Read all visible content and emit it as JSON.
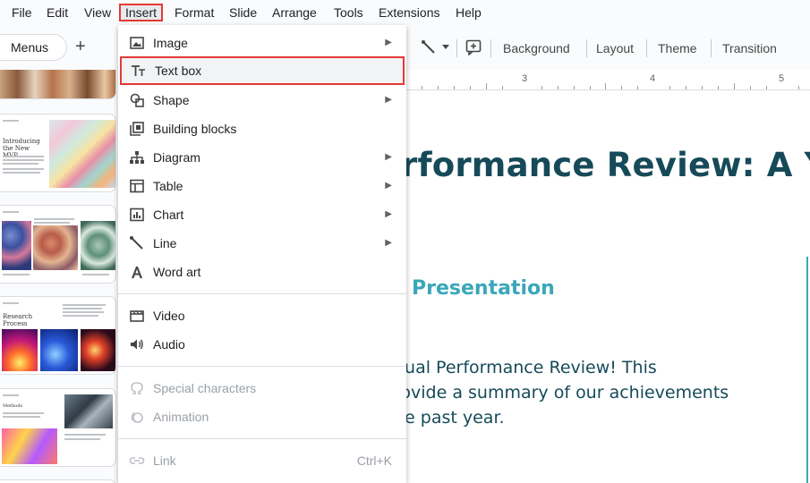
{
  "menubar": {
    "items": [
      {
        "label": "File"
      },
      {
        "label": "Edit"
      },
      {
        "label": "View"
      },
      {
        "label": "Insert"
      },
      {
        "label": "Format"
      },
      {
        "label": "Slide"
      },
      {
        "label": "Arrange"
      },
      {
        "label": "Tools"
      },
      {
        "label": "Extensions"
      },
      {
        "label": "Help"
      }
    ],
    "active": "Insert"
  },
  "toolbar": {
    "menus_label": "Menus",
    "background_label": "Background",
    "layout_label": "Layout",
    "theme_label": "Theme",
    "transition_label": "Transition"
  },
  "ruler": {
    "numbers": [
      "3",
      "4",
      "5"
    ]
  },
  "filmstrip": {
    "slides": [
      {
        "title": "Introducing the New MVP"
      },
      {
        "title": ""
      },
      {
        "title": "Research Process"
      },
      {
        "title": "Methods"
      }
    ]
  },
  "insert_menu": {
    "items": [
      {
        "label": "Image",
        "icon": "image-icon",
        "submenu": true
      },
      {
        "label": "Text box",
        "icon": "text-box-icon",
        "highlighted": true
      },
      {
        "label": "Shape",
        "icon": "shape-icon",
        "submenu": true
      },
      {
        "label": "Building blocks",
        "icon": "building-blocks-icon"
      },
      {
        "label": "Diagram",
        "icon": "diagram-icon",
        "submenu": true
      },
      {
        "label": "Table",
        "icon": "table-icon",
        "submenu": true
      },
      {
        "label": "Chart",
        "icon": "chart-icon",
        "submenu": true
      },
      {
        "label": "Line",
        "icon": "line-icon",
        "submenu": true
      },
      {
        "label": "Word art",
        "icon": "word-art-icon"
      },
      {
        "label": "Video",
        "icon": "video-icon"
      },
      {
        "label": "Audio",
        "icon": "audio-icon"
      },
      {
        "label": "Special characters",
        "icon": "omega-icon",
        "disabled": true
      },
      {
        "label": "Animation",
        "icon": "animation-icon",
        "disabled": true
      },
      {
        "label": "Link",
        "icon": "link-icon",
        "disabled": true,
        "shortcut": "Ctrl+K"
      }
    ]
  },
  "slide": {
    "title": "rformance Review: A Yea",
    "subtitle": "Presentation",
    "body_lines": [
      "nual Performance Review! This",
      "rovide a summary of our achievements",
      "he past year."
    ]
  },
  "colors": {
    "accent": "#164a59",
    "teal": "#3aa7b9",
    "highlight": "#e53935"
  }
}
